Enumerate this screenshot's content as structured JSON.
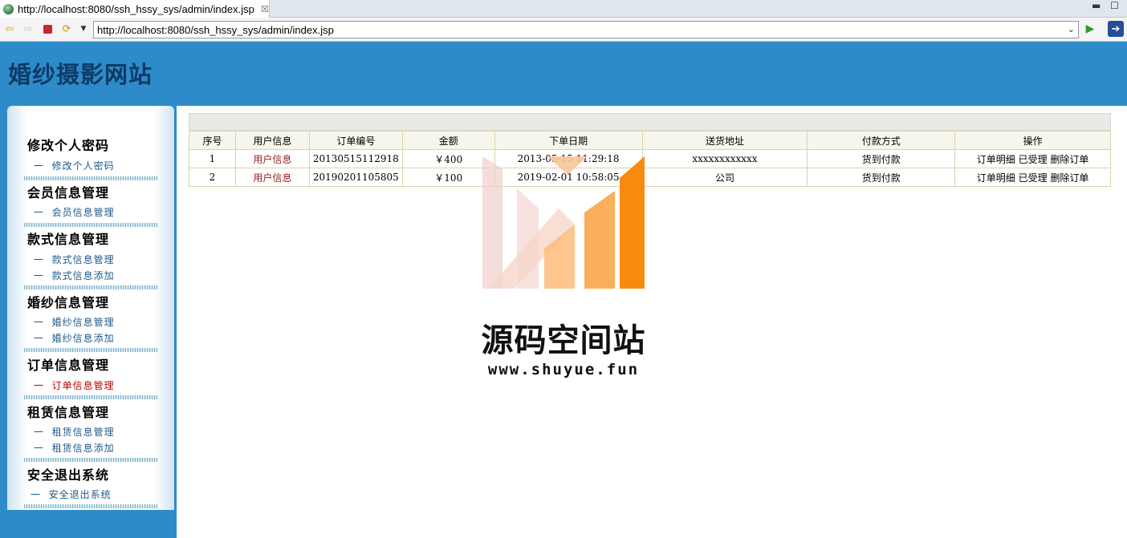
{
  "browser": {
    "tab_title": "http://localhost:8080/ssh_hssy_sys/admin/index.jsp",
    "url": "http://localhost:8080/ssh_hssy_sys/admin/index.jsp"
  },
  "site": {
    "title": "婚纱摄影网站"
  },
  "sidebar": {
    "sections": [
      {
        "heading": "修改个人密码",
        "items": [
          {
            "label": "修改个人密码"
          }
        ]
      },
      {
        "heading": "会员信息管理",
        "items": [
          {
            "label": "会员信息管理"
          }
        ]
      },
      {
        "heading": "款式信息管理",
        "items": [
          {
            "label": "款式信息管理"
          },
          {
            "label": "款式信息添加"
          }
        ]
      },
      {
        "heading": "婚纱信息管理",
        "items": [
          {
            "label": "婚纱信息管理"
          },
          {
            "label": "婚纱信息添加"
          }
        ]
      },
      {
        "heading": "订单信息管理",
        "items": [
          {
            "label": "订单信息管理"
          }
        ]
      },
      {
        "heading": "租赁信息管理",
        "items": [
          {
            "label": "租赁信息管理"
          },
          {
            "label": "租赁信息添加"
          }
        ]
      },
      {
        "heading": "安全退出系统",
        "items": [
          {
            "label": "安全退出系统"
          }
        ]
      }
    ],
    "item_prefix": "一",
    "active_item": "订单信息管理"
  },
  "orders": {
    "columns": [
      "序号",
      "用户信息",
      "订单编号",
      "金额",
      "下单日期",
      "送货地址",
      "付款方式",
      "操作"
    ],
    "rows": [
      {
        "index": "1",
        "user": "用户信息",
        "order_no": "20130515112918",
        "amount": "￥400",
        "date": "2013-05-15 11:29:18",
        "address": "xxxxxxxxxxxx",
        "payment": "货到付款",
        "actions": "订单明细 已受理 删除订单"
      },
      {
        "index": "2",
        "user": "用户信息",
        "order_no": "20190201105805",
        "amount": "￥100",
        "date": "2019-02-01 10:58:05",
        "address": "公司",
        "payment": "货到付款",
        "actions": "订单明细 已受理 删除订单"
      }
    ]
  },
  "watermark": {
    "title": "源码空间站",
    "url": "www.shuyue.fun"
  },
  "colors": {
    "header_bg": "#2e8bc9",
    "title_color": "#0e3a66",
    "active_red": "#c00000",
    "watermark_orange": "#f98a0f"
  }
}
